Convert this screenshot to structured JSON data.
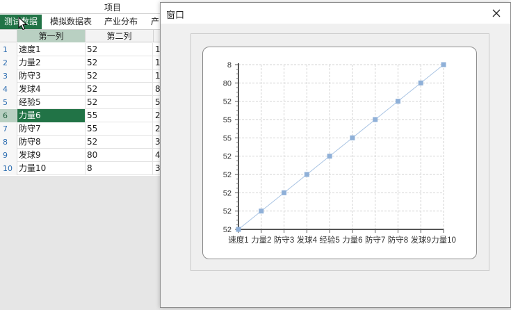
{
  "app": {
    "header_title": "项目",
    "tabs": [
      {
        "label": "测试数据",
        "active": true
      },
      {
        "label": "模拟数据表",
        "active": false
      },
      {
        "label": "产业分布",
        "active": false
      },
      {
        "label": "产",
        "active": false
      }
    ]
  },
  "grid": {
    "columns": [
      "第一列",
      "第二列"
    ],
    "selected_row": 6,
    "rows": [
      {
        "num": "1",
        "c1": "速度1",
        "c2": "52",
        "c3": "1"
      },
      {
        "num": "2",
        "c1": "力量2",
        "c2": "52",
        "c3": "1"
      },
      {
        "num": "3",
        "c1": "防守3",
        "c2": "52",
        "c3": "1"
      },
      {
        "num": "4",
        "c1": "发球4",
        "c2": "52",
        "c3": "8"
      },
      {
        "num": "5",
        "c1": "经验5",
        "c2": "52",
        "c3": "5"
      },
      {
        "num": "6",
        "c1": "力量6",
        "c2": "55",
        "c3": "2"
      },
      {
        "num": "7",
        "c1": "防守7",
        "c2": "55",
        "c3": "2"
      },
      {
        "num": "8",
        "c1": "防守8",
        "c2": "52",
        "c3": "3"
      },
      {
        "num": "9",
        "c1": "发球9",
        "c2": "80",
        "c3": "4"
      },
      {
        "num": "10",
        "c1": "力量10",
        "c2": "8",
        "c3": "3"
      }
    ]
  },
  "dialog": {
    "title": "窗口",
    "close_glyph": "✕"
  },
  "chart_data": {
    "type": "line",
    "categories": [
      "速度1",
      "力量2",
      "防守3",
      "发球4",
      "经验5",
      "力量6",
      "防守7",
      "防守8",
      "发球9",
      "力量10"
    ],
    "series": [
      {
        "values": [
          52,
          52,
          52,
          52,
          52,
          55,
          55,
          52,
          80,
          8
        ],
        "color": "#8fb0d8"
      }
    ],
    "y_tick_labels": [
      "52",
      "52",
      "52",
      "52",
      "52",
      "55",
      "55",
      "52",
      "80",
      "8"
    ],
    "grid": true,
    "marker": "square"
  },
  "colors": {
    "accent": "#217346",
    "series_line": "#a8c3e3",
    "series_marker": "#8fb0d8"
  }
}
